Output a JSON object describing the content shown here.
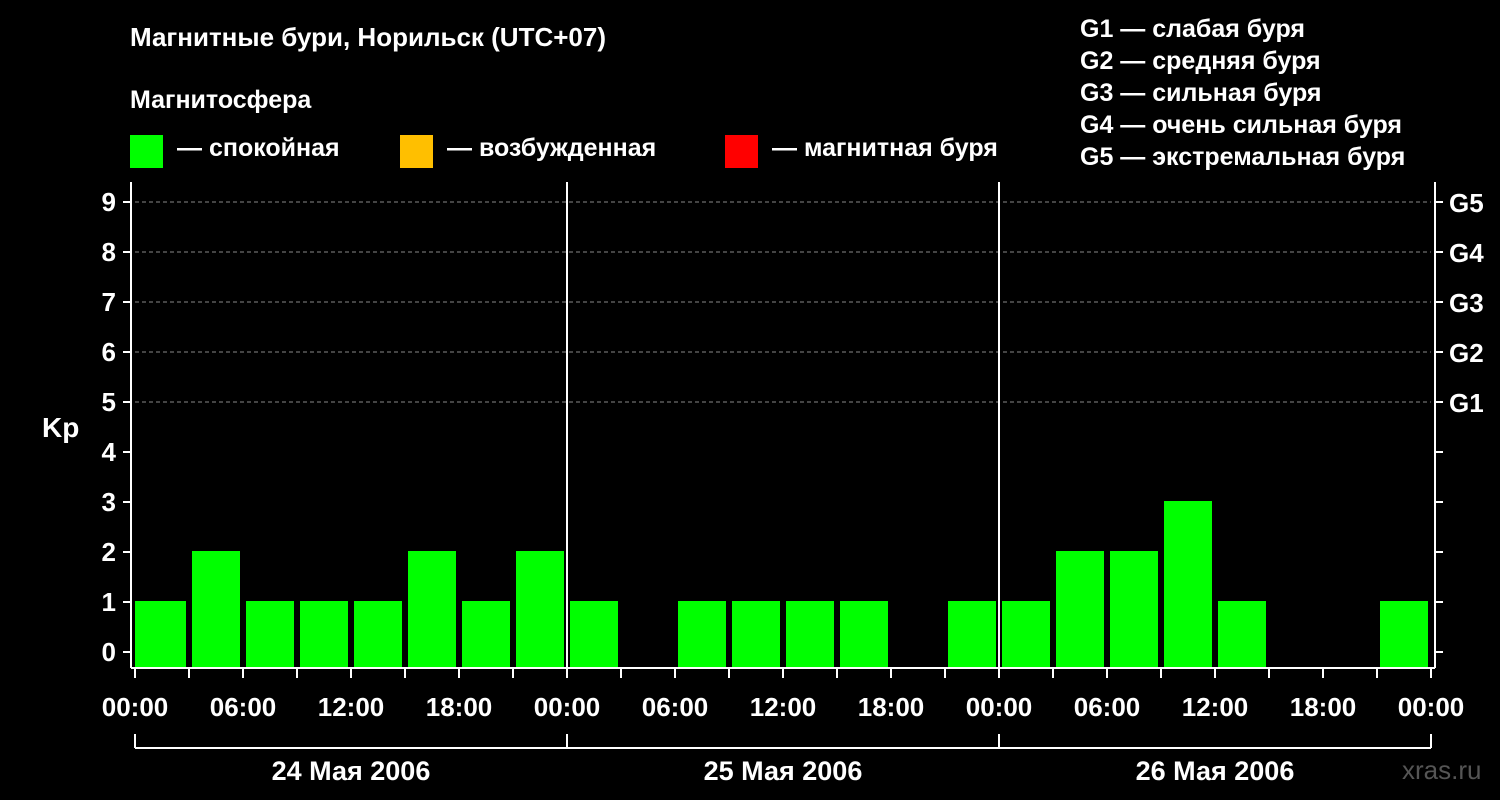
{
  "title": "Магнитные бури, Норильск (UTC+07)",
  "subtitle": "Магнитосфера",
  "legend": [
    {
      "color": "#00ff00",
      "label": "— спокойная"
    },
    {
      "color": "#ffbf00",
      "label": "— возбужденная"
    },
    {
      "color": "#ff0000",
      "label": "— магнитная буря"
    }
  ],
  "g_scale": [
    "G1 — слабая буря",
    "G2 — средняя буря",
    "G3 — сильная буря",
    "G4 — очень сильная буря",
    "G5 — экстремальная буря"
  ],
  "watermark": "xras.ru",
  "chart_data": {
    "type": "bar",
    "ylabel": "Kp",
    "ylim": [
      0,
      9
    ],
    "yticks": [
      "0",
      "1",
      "2",
      "3",
      "4",
      "5",
      "6",
      "7",
      "8",
      "9"
    ],
    "right_axis_labels": [
      {
        "kp": 5,
        "label": "G1"
      },
      {
        "kp": 6,
        "label": "G2"
      },
      {
        "kp": 7,
        "label": "G3"
      },
      {
        "kp": 8,
        "label": "G4"
      },
      {
        "kp": 9,
        "label": "G5"
      }
    ],
    "grid": "dashed horizontal at Kp 5–9",
    "x_tick_labels": [
      "00:00",
      "06:00",
      "12:00",
      "18:00",
      "00:00",
      "06:00",
      "12:00",
      "18:00",
      "00:00",
      "06:00",
      "12:00",
      "18:00",
      "00:00"
    ],
    "days": [
      "24 Мая 2006",
      "25 Мая 2006",
      "26 Мая 2006"
    ],
    "interval_hours": 3,
    "series": [
      {
        "day": "24 Мая 2006",
        "values": [
          1,
          2,
          1,
          1,
          1,
          2,
          1,
          2
        ]
      },
      {
        "day": "25 Мая 2006",
        "values": [
          1,
          0,
          1,
          1,
          1,
          1,
          0,
          1
        ]
      },
      {
        "day": "26 Мая 2006",
        "values": [
          1,
          2,
          2,
          3,
          1,
          0,
          0,
          1
        ]
      }
    ],
    "bar_color": "#00ff00"
  }
}
